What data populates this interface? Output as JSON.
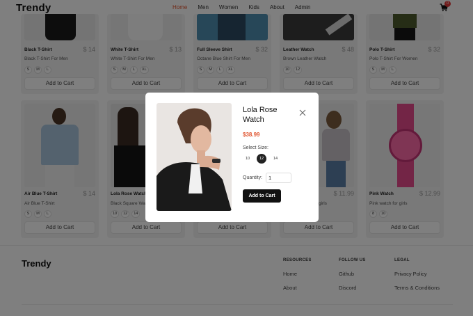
{
  "header": {
    "logo": "Trendy",
    "nav": [
      "Home",
      "Men",
      "Women",
      "Kids",
      "About",
      "Admin"
    ],
    "active_nav": "Home",
    "cart_count": "0"
  },
  "products_row1": [
    {
      "name": "Black T-Shirt",
      "price": "$ 14",
      "desc": "Black T-Shirt For Men",
      "sizes": [
        "S",
        "M",
        "L"
      ],
      "cta": "Add to Cart"
    },
    {
      "name": "White T-Shirt",
      "price": "$ 13",
      "desc": "White T-Shirt For Men",
      "sizes": [
        "S",
        "M",
        "L",
        "XL"
      ],
      "cta": "Add to Cart"
    },
    {
      "name": "Full Sleeve Shirt",
      "price": "$ 32",
      "desc": "Octane Blue Shirt For Men",
      "sizes": [
        "S",
        "M",
        "L",
        "XL"
      ],
      "cta": "Add to Cart"
    },
    {
      "name": "Leather Watch",
      "price": "$ 48",
      "desc": "Brown Leather Watch",
      "sizes": [
        "10",
        "12"
      ],
      "cta": "Add to Cart"
    },
    {
      "name": "Polo T-Shirt",
      "price": "$ 32",
      "desc": "Polo T-Shirt For Women",
      "sizes": [
        "S",
        "M",
        "L"
      ],
      "cta": "Add to Cart"
    }
  ],
  "products_row2": [
    {
      "name": "Air Blue T-Shirt",
      "price": "$ 14",
      "desc": "Air Blue T-Shirt",
      "sizes": [
        "S",
        "M",
        "L"
      ],
      "cta": "Add to Cart"
    },
    {
      "name": "Lola Rose Watch",
      "price": "",
      "desc": "Black Square Wat",
      "sizes": [
        "10",
        "12",
        "14"
      ],
      "cta": "Add to Cart"
    },
    {
      "name": "",
      "price": "",
      "desc": "",
      "sizes": [],
      "cta": "Add to Cart"
    },
    {
      "name": "",
      "price": "$ 11.99",
      "desc": "girls",
      "sizes": [],
      "cta": "Add to Cart"
    },
    {
      "name": "Pink Watch",
      "price": "$ 12.99",
      "desc": "Pink watch for girls",
      "sizes": [
        "8",
        "10"
      ],
      "cta": "Add to Cart"
    }
  ],
  "footer": {
    "logo": "Trendy",
    "resources": {
      "heading": "RESOURCES",
      "links": [
        "Home",
        "About"
      ]
    },
    "follow": {
      "heading": "FOLLOW US",
      "links": [
        "Github",
        "Discord"
      ]
    },
    "legal": {
      "heading": "LEGAL",
      "links": [
        "Privacy Policy",
        "Terms & Conditions"
      ]
    }
  },
  "modal": {
    "title": "Lola Rose Watch",
    "price": "$38.99",
    "size_label": "Select Size:",
    "sizes": [
      "10",
      "12",
      "14"
    ],
    "selected_size": "12",
    "qty_label": "Quantity:",
    "qty_value": "1",
    "add_label": "Add to Cart"
  },
  "colors": {
    "accent": "#e0542f",
    "badge": "#e23a3a",
    "overlay": "rgba(0,0,0,0.5)",
    "button_dark": "#111111"
  }
}
